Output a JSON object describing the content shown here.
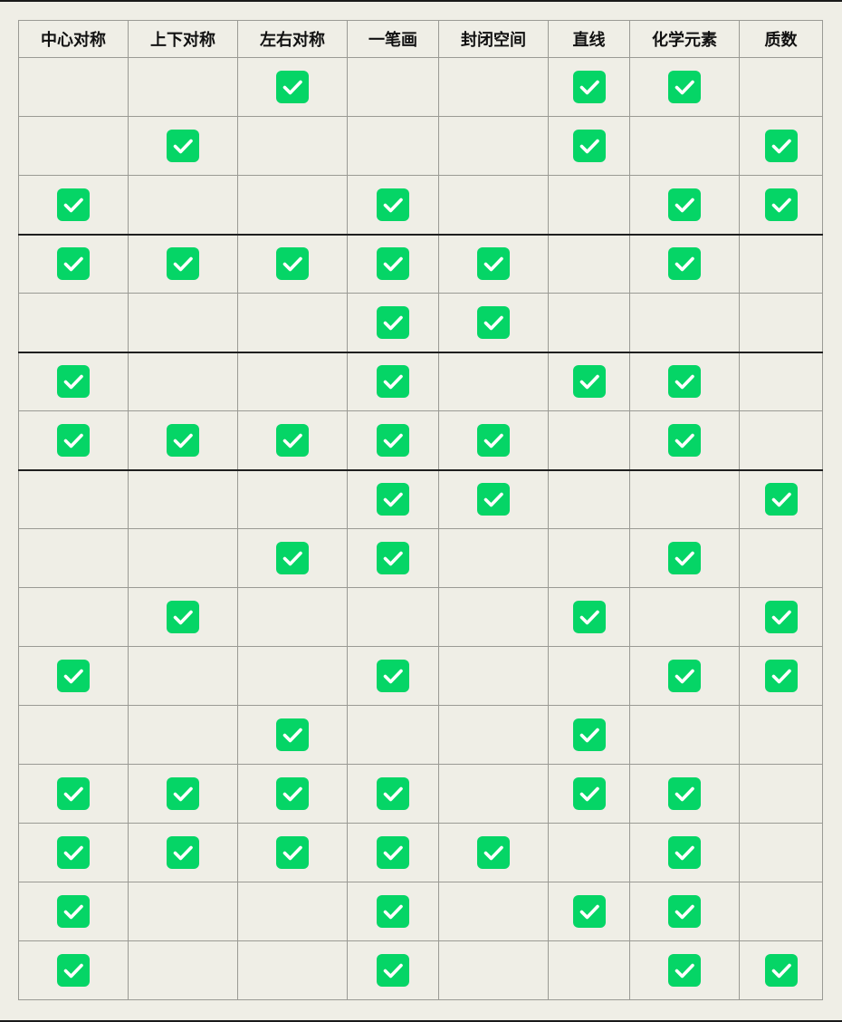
{
  "columns": [
    "中心对称",
    "上下对称",
    "左右对称",
    "一笔画",
    "封闭空间",
    "直线",
    "化学元素",
    "质数"
  ],
  "colors": {
    "background": "#efeee6",
    "check": "#05d566",
    "grid": "#9a9a94",
    "group_divider": "#1f1f1f"
  },
  "icon": "checkbox-checked-icon",
  "group_start_rows": [
    3,
    5,
    7
  ],
  "rows": [
    [
      false,
      false,
      true,
      false,
      false,
      true,
      true,
      false
    ],
    [
      false,
      true,
      false,
      false,
      false,
      true,
      false,
      true
    ],
    [
      true,
      false,
      false,
      true,
      false,
      false,
      true,
      true
    ],
    [
      true,
      true,
      true,
      true,
      true,
      false,
      true,
      false
    ],
    [
      false,
      false,
      false,
      true,
      true,
      false,
      false,
      false
    ],
    [
      true,
      false,
      false,
      true,
      false,
      true,
      true,
      false
    ],
    [
      true,
      true,
      true,
      true,
      true,
      false,
      true,
      false
    ],
    [
      false,
      false,
      false,
      true,
      true,
      false,
      false,
      true
    ],
    [
      false,
      false,
      true,
      true,
      false,
      false,
      true,
      false
    ],
    [
      false,
      true,
      false,
      false,
      false,
      true,
      false,
      true
    ],
    [
      true,
      false,
      false,
      true,
      false,
      false,
      true,
      true
    ],
    [
      false,
      false,
      true,
      false,
      false,
      true,
      false,
      false
    ],
    [
      true,
      true,
      true,
      true,
      false,
      true,
      true,
      false
    ],
    [
      true,
      true,
      true,
      true,
      true,
      false,
      true,
      false
    ],
    [
      true,
      false,
      false,
      true,
      false,
      true,
      true,
      false
    ],
    [
      true,
      false,
      false,
      true,
      false,
      false,
      true,
      true
    ]
  ]
}
